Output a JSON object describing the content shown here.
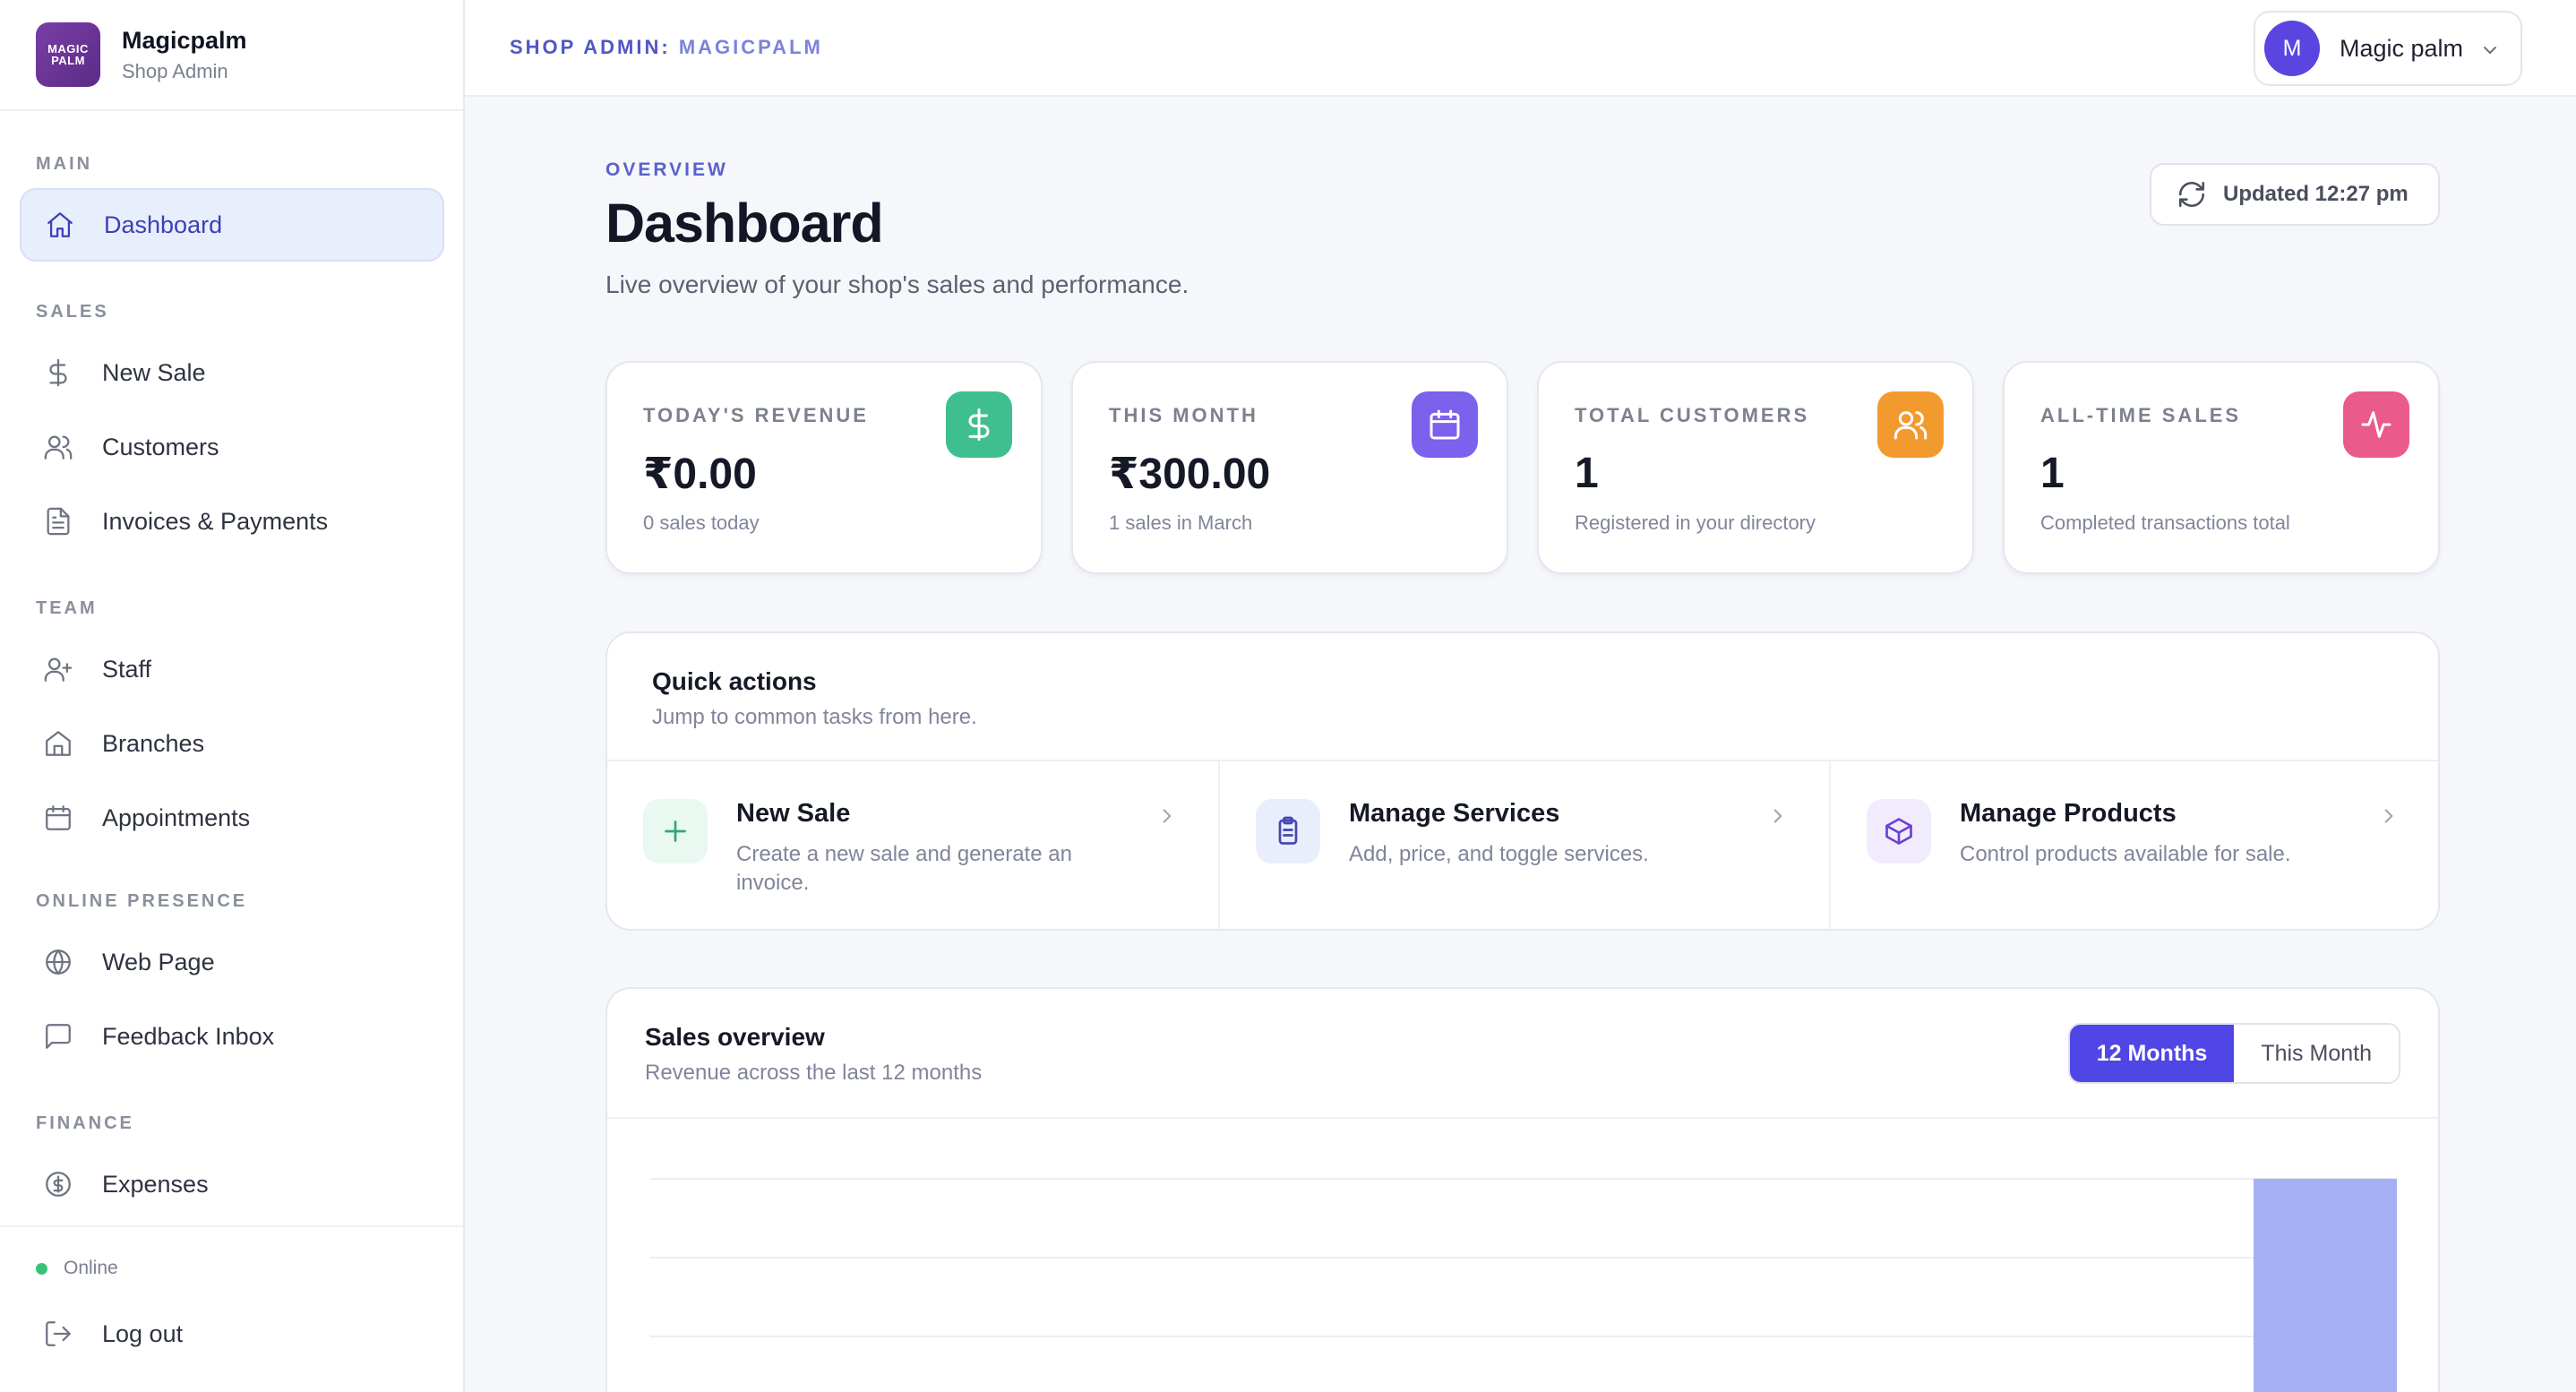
{
  "brand": {
    "logo_text": "MAGIC PALM",
    "name": "Magicpalm",
    "subtitle": "Shop Admin"
  },
  "sidebar": {
    "sections": [
      {
        "title": "MAIN",
        "items": [
          {
            "label": "Dashboard",
            "icon": "home-icon",
            "active": true
          }
        ]
      },
      {
        "title": "SALES",
        "items": [
          {
            "label": "New Sale",
            "icon": "dollar-icon"
          },
          {
            "label": "Customers",
            "icon": "users-icon"
          },
          {
            "label": "Invoices & Payments",
            "icon": "document-icon"
          }
        ]
      },
      {
        "title": "TEAM",
        "items": [
          {
            "label": "Staff",
            "icon": "user-plus-icon"
          },
          {
            "label": "Branches",
            "icon": "building-icon"
          },
          {
            "label": "Appointments",
            "icon": "calendar-icon"
          }
        ]
      },
      {
        "title": "ONLINE PRESENCE",
        "items": [
          {
            "label": "Web Page",
            "icon": "globe-icon"
          },
          {
            "label": "Feedback Inbox",
            "icon": "message-icon"
          }
        ]
      },
      {
        "title": "FINANCE",
        "items": [
          {
            "label": "Expenses",
            "icon": "coin-icon"
          }
        ]
      }
    ],
    "status": "Online",
    "logout_label": "Log out"
  },
  "topbar": {
    "crumb_prefix": "SHOP ADMIN:",
    "crumb_shop": "MAGICPALM",
    "user": {
      "initial": "M",
      "name": "Magic palm"
    }
  },
  "header": {
    "overline": "OVERVIEW",
    "title": "Dashboard",
    "subtitle": "Live overview of your shop's sales and performance.",
    "updated_label": "Updated 12:27 pm"
  },
  "stats": [
    {
      "label": "TODAY'S REVENUE",
      "value": "₹0.00",
      "note": "0 sales today",
      "icon": "dollar-icon",
      "color": "#3fbf8f"
    },
    {
      "label": "THIS MONTH",
      "value": "₹300.00",
      "note": "1 sales in March",
      "icon": "calendar-icon",
      "color": "#7b61ec"
    },
    {
      "label": "TOTAL CUSTOMERS",
      "value": "1",
      "note": "Registered in your directory",
      "icon": "users-icon",
      "color": "#f29a2e"
    },
    {
      "label": "ALL-TIME SALES",
      "value": "1",
      "note": "Completed transactions total",
      "icon": "activity-icon",
      "color": "#ea5a8a"
    }
  ],
  "quick_actions": {
    "title": "Quick actions",
    "subtitle": "Jump to common tasks from here.",
    "items": [
      {
        "name": "New Sale",
        "desc": "Create a new sale and generate an invoice.",
        "icon": "plus-icon",
        "bg": "#e9f8f1",
        "fg": "#2fa872"
      },
      {
        "name": "Manage Services",
        "desc": "Add, price, and toggle services.",
        "icon": "clipboard-icon",
        "bg": "#eaeefc",
        "fg": "#4449b4"
      },
      {
        "name": "Manage Products",
        "desc": "Control products available for sale.",
        "icon": "box-icon",
        "bg": "#f1ecfd",
        "fg": "#6c3fd6"
      }
    ]
  },
  "sales": {
    "title": "Sales overview",
    "subtitle": "Revenue across the last 12 months",
    "toggle": [
      "12 Months",
      "This Month"
    ],
    "active_toggle": 0
  },
  "chart_data": {
    "type": "bar",
    "values": [
      0,
      0,
      0,
      0,
      0,
      0,
      0,
      0,
      0,
      0,
      0,
      300
    ],
    "bar_color": "#a5b0f5",
    "grid": true
  }
}
